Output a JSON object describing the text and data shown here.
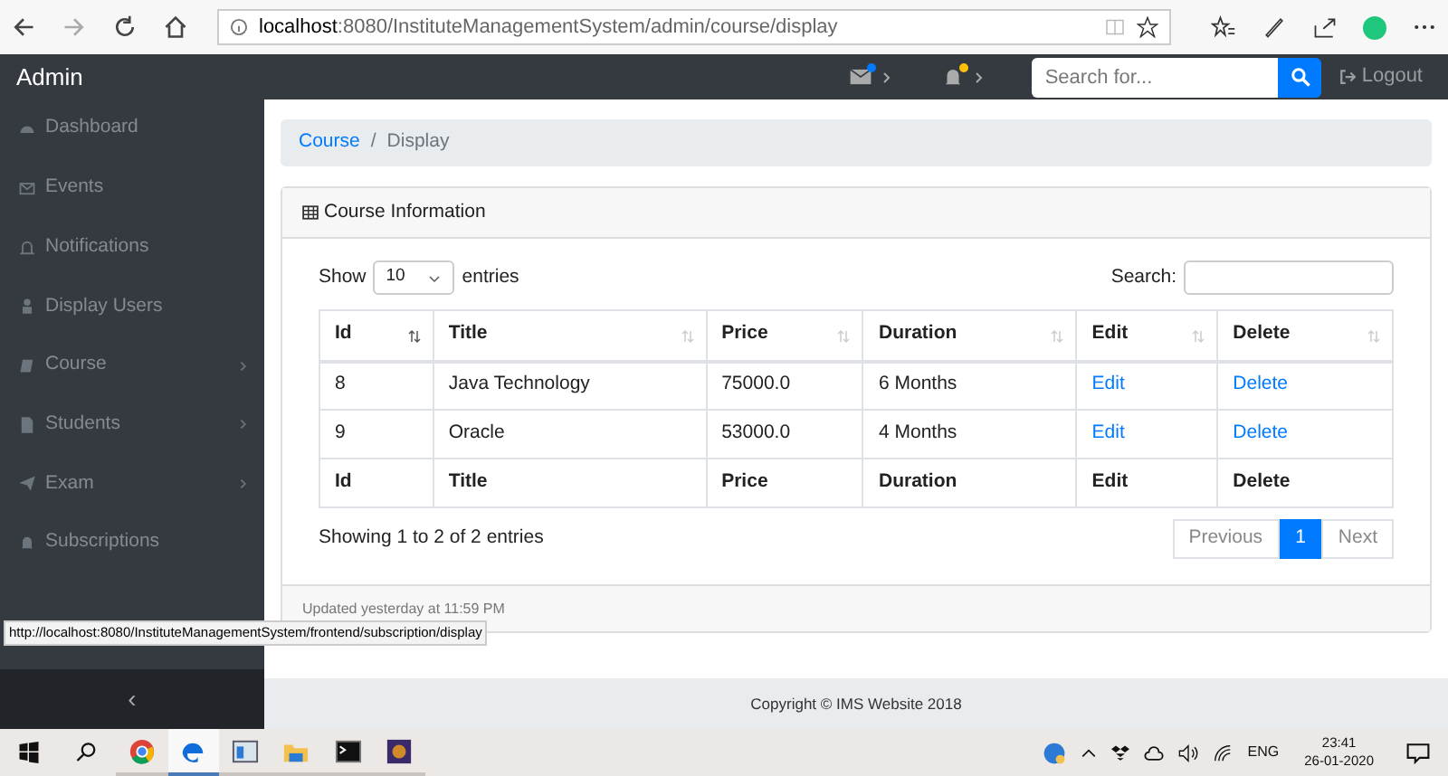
{
  "browser": {
    "url_host": "localhost",
    "url_rest": ":8080/InstituteManagementSystem/admin/course/display"
  },
  "navbar": {
    "brand": "Admin",
    "search_placeholder": "Search for...",
    "logout": "Logout"
  },
  "sidebar": {
    "items": [
      {
        "label": "Dashboard",
        "kind": "link"
      },
      {
        "label": "Events",
        "kind": "link"
      },
      {
        "label": "Notifications",
        "kind": "link"
      },
      {
        "label": "Display Users",
        "kind": "link"
      },
      {
        "label": "Course",
        "kind": "dropdown"
      },
      {
        "label": "Students",
        "kind": "dropdown"
      },
      {
        "label": "Exam",
        "kind": "dropdown"
      },
      {
        "label": "Subscriptions",
        "kind": "link"
      }
    ],
    "toggle": "‹"
  },
  "breadcrumb": [
    {
      "label": "Course",
      "selected": false
    },
    {
      "label": "Display",
      "selected": true
    }
  ],
  "breadcrumb_separator": "/",
  "card": {
    "title": "Course Information",
    "show_label": "Show",
    "page_size": "10",
    "entries_label": "entries",
    "search_label": "Search:",
    "table": {
      "columns": [
        "Id",
        "Title",
        "Price",
        "Duration",
        "Edit",
        "Delete"
      ],
      "rows": [
        [
          "8",
          "Java Technology",
          "75000.0",
          "6 Months",
          "Edit",
          "Delete"
        ],
        [
          "9",
          "Oracle",
          "53000.0",
          "4 Months",
          "Edit",
          "Delete"
        ]
      ],
      "footer": [
        "Id",
        "Title",
        "Price",
        "Duration",
        "Edit",
        "Delete"
      ]
    },
    "info": "Showing 1 to 2 of 2 entries",
    "pagination": [
      {
        "label": "Previous",
        "selected": false
      },
      {
        "label": "1",
        "selected": true
      },
      {
        "label": "Next",
        "selected": false
      }
    ],
    "updated": "Updated yesterday at 11:59 PM"
  },
  "status_url": "http://localhost:8080/InstituteManagementSystem/frontend/subscription/display",
  "footer": "Copyright © IMS Website 2018",
  "taskbar": {
    "apps": [
      {
        "selected": false
      },
      {
        "selected": true
      },
      {
        "selected": false
      },
      {
        "selected": false
      },
      {
        "selected": false
      },
      {
        "selected": false
      }
    ],
    "lang": "ENG",
    "time": "23:41",
    "date": "26-01-2020"
  }
}
